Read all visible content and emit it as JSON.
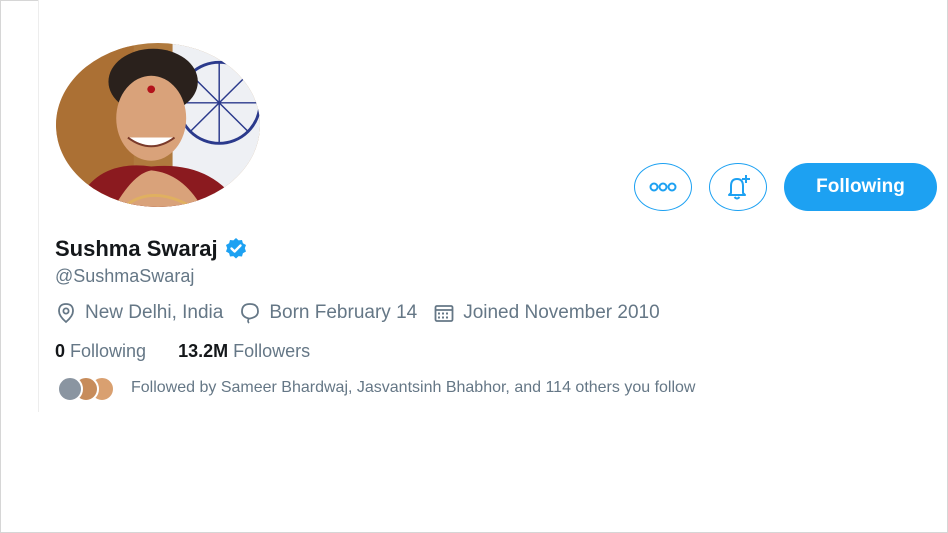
{
  "profile": {
    "name": "Sushma Swaraj",
    "handle": "@SushmaSwaraj",
    "location": "New Delhi, India",
    "born": "Born February 14",
    "joined": "Joined November 2010"
  },
  "actions": {
    "more_icon": "more-dots-icon",
    "notify_icon": "bell-plus-icon",
    "following_label": "Following"
  },
  "stats": {
    "following_count": "0",
    "following_label": "Following",
    "followers_count": "13.2M",
    "followers_label": "Followers"
  },
  "followed_by": "Followed by Sameer Bhardwaj, Jasvantsinh Bhabhor, and 114 others you follow",
  "colors": {
    "accent": "#1da1f2",
    "text_primary": "#14171a",
    "text_secondary": "#657786"
  }
}
